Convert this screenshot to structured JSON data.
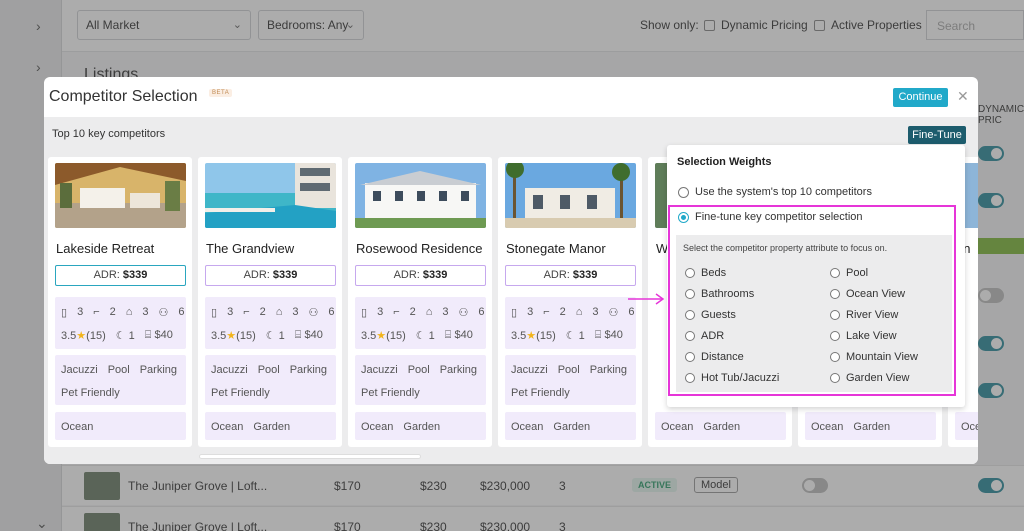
{
  "background": {
    "market_select": "All Market",
    "bedrooms_select": "Bedrooms: Any",
    "show_only_label": "Show only:",
    "dynamic_pricing_label": "Dynamic Pricing",
    "active_properties_label": "Active Properties",
    "search_placeholder": "Search",
    "listings_title": "Listings",
    "right_column_header": "DYNAMIC PRIC",
    "rows": [
      {
        "name": "The Juniper Grove | Loft...",
        "price1": "$170",
        "price2": "$230",
        "price3": "$230,000",
        "beds": "3",
        "status": "ACTIVE",
        "model": "Model"
      },
      {
        "name": "The Juniper Grove | Loft...",
        "price1": "$170",
        "price2": "$230",
        "price3": "$230,000",
        "beds": "3",
        "status": "",
        "model": ""
      }
    ]
  },
  "modal": {
    "title": "Competitor Selection",
    "beta_badge": "BETA",
    "continue_label": "Continue",
    "close_icon": "close-icon",
    "subtitle": "Top 10 key competitors",
    "finetune_label": "Fine-Tune"
  },
  "cards": [
    {
      "name": "Lakeside Retreat",
      "adr_label": "ADR:",
      "adr_value": "$339",
      "selected": true,
      "beds": "3",
      "baths": "2",
      "bedrooms": "3",
      "guests": "6",
      "rating": "3.5",
      "reviews": "(15)",
      "nights": "1",
      "fee": "$40",
      "amenities_row1": [
        "Jacuzzi",
        "Pool",
        "Parking"
      ],
      "amenities_row2": [
        "Pet Friendly"
      ],
      "views": [
        "Ocean"
      ]
    },
    {
      "name": "The Grandview",
      "adr_label": "ADR:",
      "adr_value": "$339",
      "selected": false,
      "beds": "3",
      "baths": "2",
      "bedrooms": "3",
      "guests": "6",
      "rating": "3.5",
      "reviews": "(15)",
      "nights": "1",
      "fee": "$40",
      "amenities_row1": [
        "Jacuzzi",
        "Pool",
        "Parking"
      ],
      "amenities_row2": [
        "Pet Friendly"
      ],
      "views": [
        "Ocean",
        "Garden"
      ]
    },
    {
      "name": "Rosewood Residence",
      "adr_label": "ADR:",
      "adr_value": "$339",
      "selected": false,
      "beds": "3",
      "baths": "2",
      "bedrooms": "3",
      "guests": "6",
      "rating": "3.5",
      "reviews": "(15)",
      "nights": "1",
      "fee": "$40",
      "amenities_row1": [
        "Jacuzzi",
        "Pool",
        "Parking"
      ],
      "amenities_row2": [
        "Pet Friendly"
      ],
      "views": [
        "Ocean",
        "Garden"
      ]
    },
    {
      "name": "Stonegate Manor",
      "adr_label": "ADR:",
      "adr_value": "$339",
      "selected": false,
      "beds": "3",
      "baths": "2",
      "bedrooms": "3",
      "guests": "6",
      "rating": "3.5",
      "reviews": "(15)",
      "nights": "1",
      "fee": "$40",
      "amenities_row1": [
        "Jacuzzi",
        "Pool",
        "Parking"
      ],
      "amenities_row2": [
        "Pet Friendly"
      ],
      "views": [
        "Ocean",
        "Garden"
      ]
    },
    {
      "name": "W",
      "views": [
        "Ocean",
        "Garden"
      ]
    },
    {
      "name": "",
      "views": [
        "Ocean",
        "Garden"
      ]
    },
    {
      "name": "on",
      "views": [
        "Oce"
      ]
    }
  ],
  "weights": {
    "title": "Selection Weights",
    "option_system": "Use the system's top 10 competitors",
    "option_finetune": "Fine-tune key competitor selection",
    "focus_text": "Select the competitor property attribute to focus on.",
    "attributes_left": [
      "Beds",
      "Bathrooms",
      "Guests",
      "ADR",
      "Distance",
      "Hot Tub/Jacuzzi"
    ],
    "attributes_right": [
      "Pool",
      "Ocean View",
      "River View",
      "Lake View",
      "Mountain View",
      "Garden View"
    ]
  },
  "colors": {
    "accent": "#21a9c9",
    "finetune_button": "#1d5c6d",
    "highlight": "#e635d8",
    "chip_bg": "#f1ebfb"
  }
}
